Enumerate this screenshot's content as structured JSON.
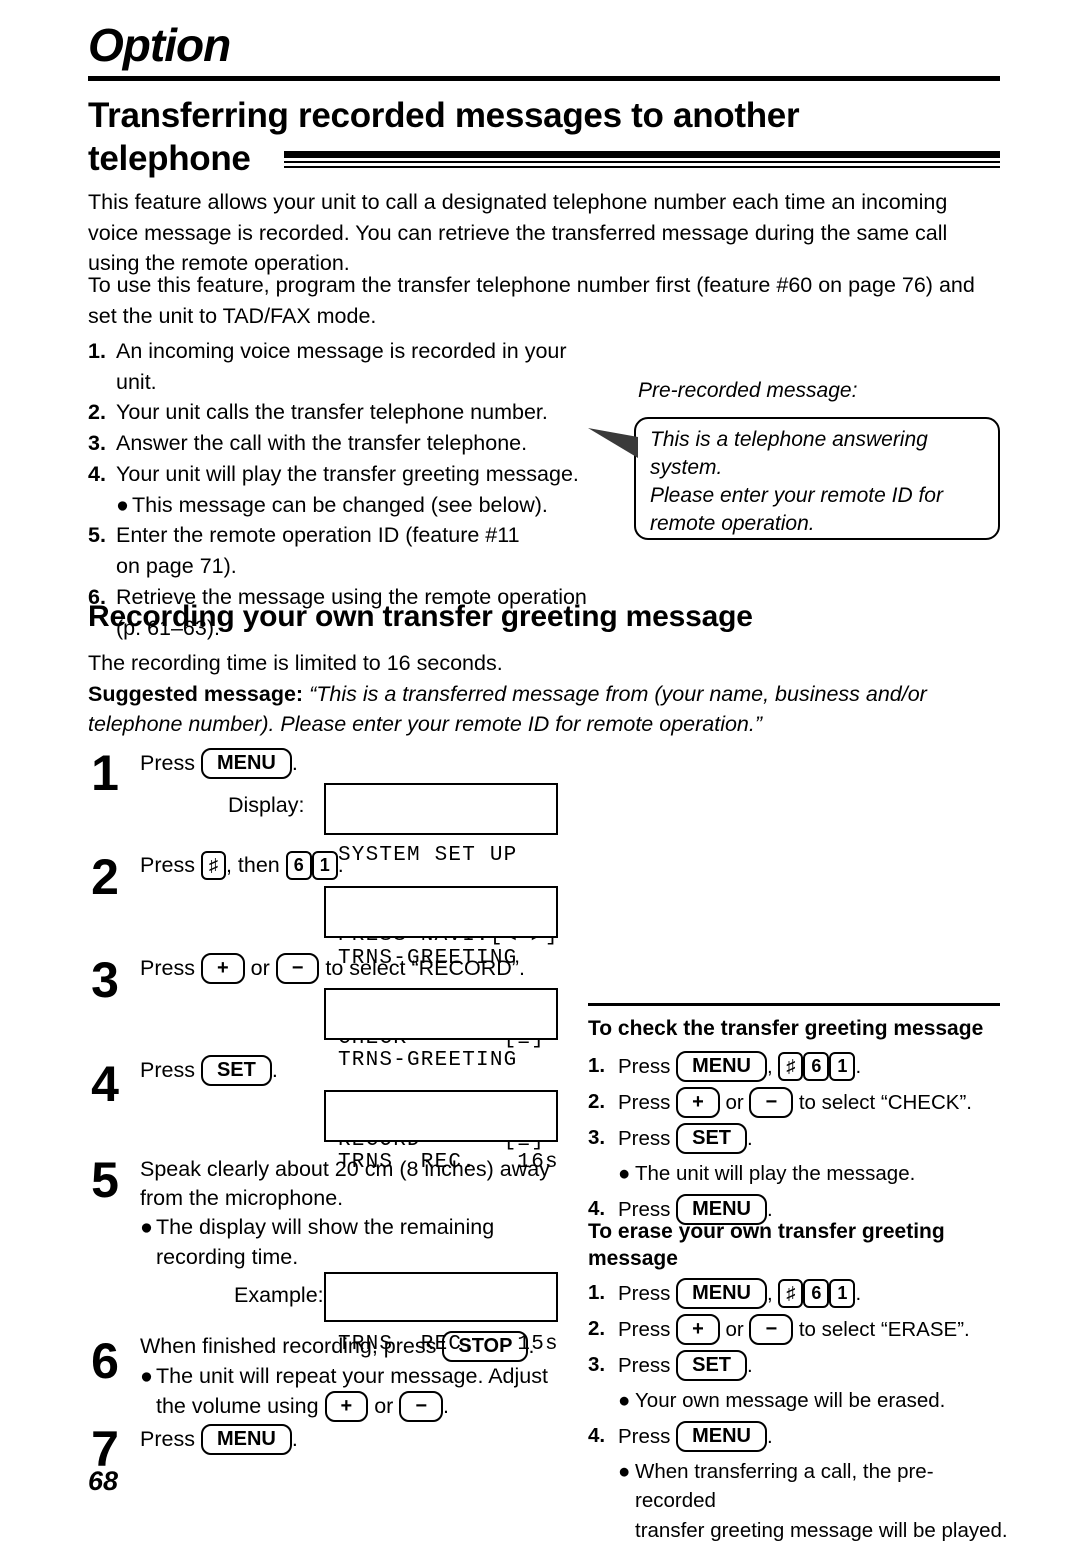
{
  "header": {
    "section_label": "Option",
    "main_title_line1": "Transferring recorded messages to another",
    "main_title_line2": "telephone"
  },
  "intro": {
    "paragraph1": "This feature allows your unit to call a designated telephone number each time an incoming voice message is recorded. You can retrieve the transferred message during the same call using the remote operation.",
    "paragraph2": "To use this feature, program the transfer telephone number first (feature #60 on page 76) and set the unit to TAD/FAX mode.",
    "steps": [
      {
        "num": "1.",
        "text": "An incoming voice message is recorded in your unit."
      },
      {
        "num": "2.",
        "text": "Your unit calls the transfer telephone number."
      },
      {
        "num": "3.",
        "text": "Answer the call with the transfer telephone."
      },
      {
        "num": "4.",
        "text": "Your unit will play the transfer greeting message."
      },
      {
        "num": "5.",
        "text": "Enter the remote operation ID (feature #11",
        "cont": "on page 71)."
      },
      {
        "num": "6.",
        "text": "Retrieve the message using the remote operation",
        "cont": "(p. 61–63)."
      }
    ],
    "step4_bullet": "This message can be changed (see below)."
  },
  "callout": {
    "label": "Pre-recorded message:",
    "line1": "This is a telephone answering",
    "line2": "system.",
    "line3": "Please enter your remote ID for",
    "line4": "remote operation."
  },
  "recording_section": {
    "heading": "Recording your own transfer greeting message",
    "intro_line": "The recording time is limited to 16 seconds.",
    "suggested_label": "Suggested message:",
    "suggested_text": "“This is a transferred message from (your name, business and/or telephone number). Please enter your remote ID for remote operation.”"
  },
  "steps": {
    "s1": {
      "num": "1",
      "press_word": "Press",
      "key_menu": "MENU",
      "period": ".",
      "display_label": "Display:",
      "lcd_line1": "SYSTEM SET UP",
      "lcd_line2": "PRESS NAVI.[◄ ►]"
    },
    "s2": {
      "num": "2",
      "press_word": "Press",
      "key_hash": "♯",
      "then_word": ", then",
      "key_6": "6",
      "key_1": "1",
      "period": ".",
      "lcd_line1": "TRNS-GREETING",
      "lcd_line2": "CHECK       [±]"
    },
    "s3": {
      "num": "3",
      "press_word": "Press",
      "key_plus": "+",
      "or_word": "or",
      "key_minus": "−",
      "tail": "to select “RECORD”.",
      "lcd_line1": "TRNS-GREETING",
      "lcd_line2": "RECORD      [±]"
    },
    "s4": {
      "num": "4",
      "press_word": "Press",
      "key_set": "SET",
      "period": ".",
      "lcd_line1": "TRNS  REC.   16s"
    },
    "s5": {
      "num": "5",
      "line1": "Speak clearly about 20 cm (8 inches) away",
      "line2": "from the microphone.",
      "bullet1": "The display will show the remaining",
      "bullet1_cont": "recording time.",
      "example_label": "Example:",
      "lcd_line1": "TRNS  REC.   15s"
    },
    "s6": {
      "num": "6",
      "lead": "When finished recording, press",
      "key_stop": "STOP",
      "period": ".",
      "bullet1a": "The unit will repeat your message. Adjust",
      "bullet1b_pre": "the volume using",
      "key_plus": "+",
      "or_word": "or",
      "key_minus": "−",
      "bullet1b_post": "."
    },
    "s7": {
      "num": "7",
      "press_word": "Press",
      "key_menu": "MENU",
      "period": "."
    }
  },
  "check_section": {
    "heading": "To check the transfer greeting message",
    "items": [
      {
        "num": "1.",
        "pre": "Press",
        "keys": [
          "MENU",
          ",",
          "♯",
          "6",
          "1"
        ],
        "post": "."
      },
      {
        "num": "2.",
        "pre": "Press",
        "keys": [
          "+",
          "or",
          "−"
        ],
        "post": "to select “CHECK”."
      },
      {
        "num": "3.",
        "pre": "Press",
        "keys": [
          "SET"
        ],
        "post": "."
      },
      {
        "num": "4.",
        "pre": "Press",
        "keys": [
          "MENU"
        ],
        "post": "."
      }
    ],
    "bullet_after_3": "The unit will play the message."
  },
  "erase_section": {
    "heading_line1": "To erase your own transfer greeting",
    "heading_line2": "message",
    "items": [
      {
        "num": "1.",
        "pre": "Press",
        "keys": [
          "MENU",
          ",",
          "♯",
          "6",
          "1"
        ],
        "post": "."
      },
      {
        "num": "2.",
        "pre": "Press",
        "keys": [
          "+",
          "or",
          "−"
        ],
        "post": "to select “ERASE”."
      },
      {
        "num": "3.",
        "pre": "Press",
        "keys": [
          "SET"
        ],
        "post": "."
      },
      {
        "num": "4.",
        "pre": "Press",
        "keys": [
          "MENU"
        ],
        "post": "."
      }
    ],
    "bullet_after_3": "Your own message will be erased.",
    "bullet_after_4_line1": "When transferring a call, the pre-recorded",
    "bullet_after_4_line2": "transfer greeting message will be played."
  },
  "footer": {
    "page_number": "68"
  },
  "colors": {
    "ink": "#000000",
    "pointer": "#3a3a3a"
  }
}
